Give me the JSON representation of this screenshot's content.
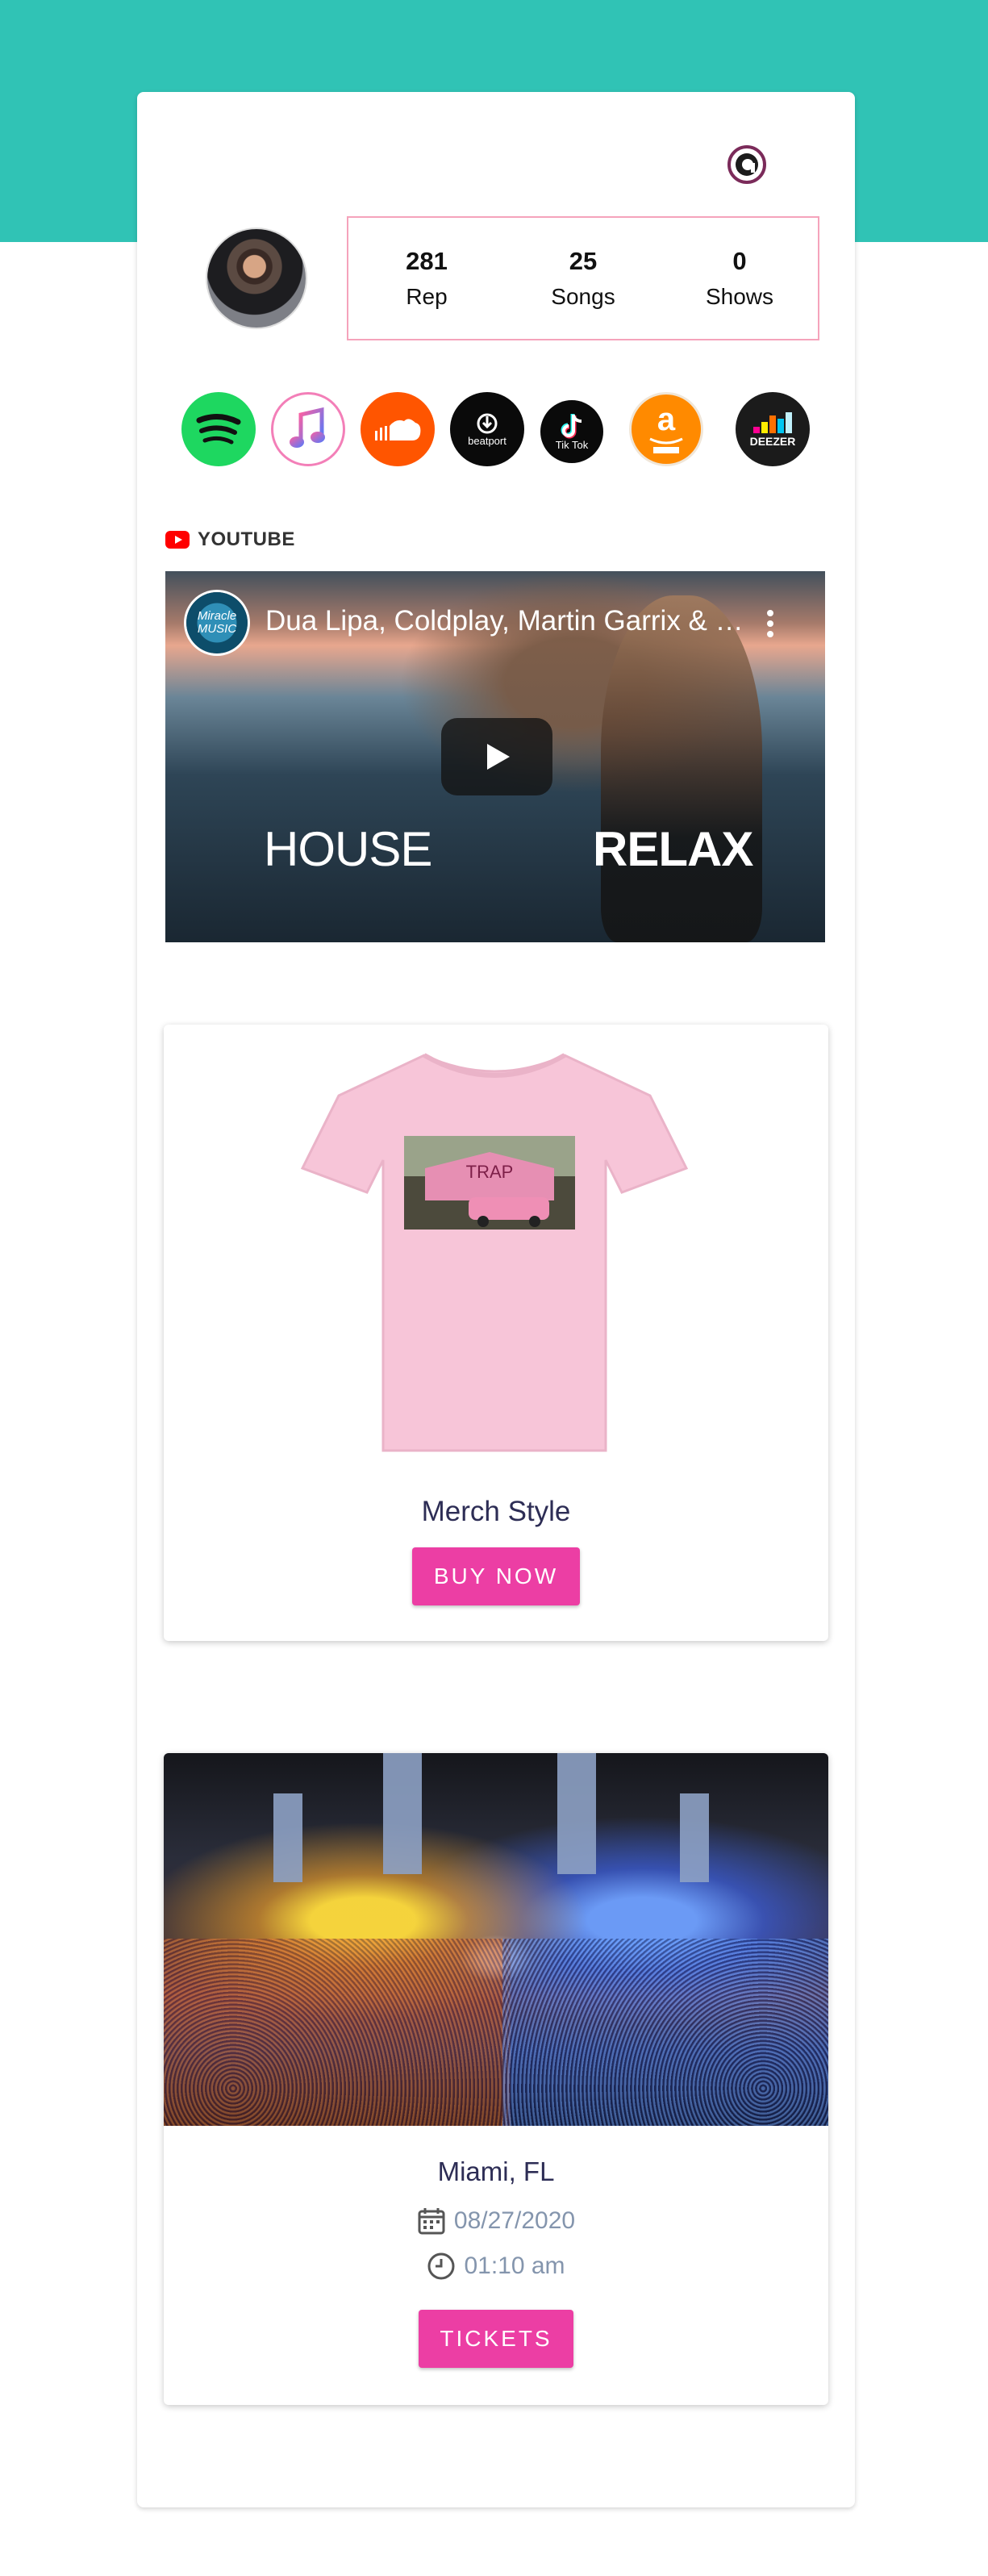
{
  "profile": {
    "stats": [
      {
        "value": "281",
        "label": "Rep"
      },
      {
        "value": "25",
        "label": "Songs"
      },
      {
        "value": "0",
        "label": "Shows"
      }
    ]
  },
  "socials": [
    {
      "name": "spotify",
      "label": ""
    },
    {
      "name": "apple-music",
      "label": ""
    },
    {
      "name": "soundcloud",
      "label": ""
    },
    {
      "name": "beatport",
      "label": "beatport"
    },
    {
      "name": "tiktok",
      "label": "Tik Tok"
    },
    {
      "name": "amazon-music",
      "label": "a"
    },
    {
      "name": "deezer",
      "label": "DEEZER"
    }
  ],
  "youtube": {
    "section_label": "YOUTUBE",
    "video_title": "Dua Lipa, Coldplay, Martin Garrix & Kygo, The Chainsmokers Style",
    "channel_logo_text": "Miracle MUSIC",
    "overlay_left": "HOUSE",
    "overlay_right": "RELAX"
  },
  "merch": {
    "title": "Merch Style",
    "button_label": "BUY NOW",
    "print_text": "TRAP"
  },
  "show": {
    "city": "Miami, FL",
    "date": "08/27/2020",
    "time": "01:10 am",
    "button_label": "TICKETS"
  },
  "colors": {
    "teal": "#30c3b5",
    "accent_pink": "#ec3ea4",
    "stats_border": "#f5a3bb",
    "title_navy": "#2d2d55",
    "meta_gray": "#8495ad"
  }
}
